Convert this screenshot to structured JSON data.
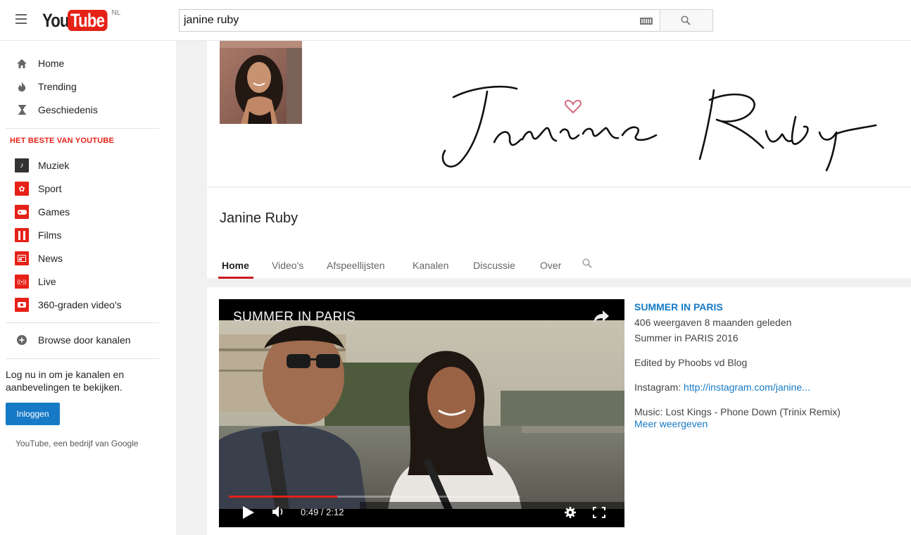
{
  "header": {
    "logo_you": "You",
    "logo_tube": "Tube",
    "logo_region": "NL",
    "search_value": "janine ruby"
  },
  "sidebar": {
    "primary": [
      {
        "label": "Home",
        "icon": "home-icon"
      },
      {
        "label": "Trending",
        "icon": "flame-icon"
      },
      {
        "label": "Geschiedenis",
        "icon": "hourglass-icon"
      }
    ],
    "section_title": "HET BESTE VAN YOUTUBE",
    "categories": [
      {
        "label": "Muziek",
        "icon": "music-icon",
        "color": "#333333"
      },
      {
        "label": "Sport",
        "icon": "sport-icon",
        "color": "#e62117"
      },
      {
        "label": "Games",
        "icon": "gamepad-icon",
        "color": "#e62117"
      },
      {
        "label": "Films",
        "icon": "film-icon",
        "color": "#e62117"
      },
      {
        "label": "News",
        "icon": "news-icon",
        "color": "#e62117"
      },
      {
        "label": "Live",
        "icon": "live-icon",
        "color": "#e62117"
      },
      {
        "label": "360-graden video's",
        "icon": "vr360-icon",
        "color": "#e62117"
      }
    ],
    "browse_label": "Browse door kanalen",
    "login_text": "Log nu in om je kanalen en aanbevelingen te bekijken.",
    "login_button": "Inloggen",
    "footer": "YouTube, een bedrijf van Google"
  },
  "channel": {
    "name": "Janine Ruby",
    "tabs": [
      "Home",
      "Video's",
      "Afspeellijsten",
      "Kanalen",
      "Discussie",
      "Over"
    ],
    "active_tab": "Home"
  },
  "featured": {
    "player_title": "SUMMER IN PARIS",
    "time": "0:49 / 2:12",
    "progress_fraction": 0.371,
    "title": "SUMMER IN PARIS",
    "meta": "406 weergaven  8 maanden geleden",
    "line1": "Summer in PARIS 2016",
    "edited": "Edited by Phoobs vd Blog",
    "instagram_label": "Instagram: ",
    "instagram_link": "http://instagram.com/janine...",
    "music": "Music: Lost Kings - Phone Down (Trinix Remix)",
    "more": "Meer weergeven"
  },
  "colors": {
    "brand_red": "#e62117",
    "link_blue": "#167ac6"
  }
}
